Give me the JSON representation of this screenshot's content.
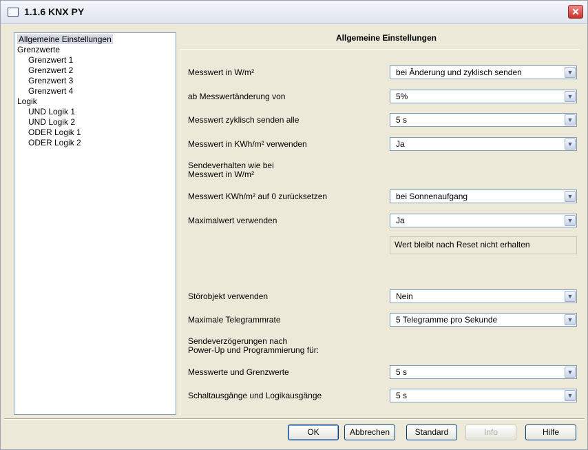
{
  "window": {
    "title": "1.1.6 KNX PY"
  },
  "tree": [
    {
      "label": "Allgemeine Einstellungen",
      "level": 0,
      "selected": true
    },
    {
      "label": "Grenzwerte",
      "level": 0
    },
    {
      "label": "Grenzwert 1",
      "level": 1
    },
    {
      "label": "Grenzwert 2",
      "level": 1
    },
    {
      "label": "Grenzwert 3",
      "level": 1
    },
    {
      "label": "Grenzwert 4",
      "level": 1
    },
    {
      "label": "Logik",
      "level": 0
    },
    {
      "label": "UND Logik 1",
      "level": 1
    },
    {
      "label": "UND Logik 2",
      "level": 1
    },
    {
      "label": "ODER Logik 1",
      "level": 1
    },
    {
      "label": "ODER Logik 2",
      "level": 1
    }
  ],
  "panel": {
    "title": "Allgemeine Einstellungen",
    "settings": [
      {
        "label": "Messwert in W/m²",
        "value": "bei Änderung und zyklisch senden"
      },
      {
        "label": "ab Messwertänderung von",
        "value": "5%"
      },
      {
        "label": "Messwert zyklisch senden alle",
        "value": "5 s"
      },
      {
        "label": "Messwert in KWh/m² verwenden",
        "value": "Ja"
      },
      {
        "label": "Sendeverhalten wie bei",
        "label2": "Messwert in W/m²"
      },
      {
        "label": "Messwert KWh/m² auf 0 zurücksetzen",
        "value": "bei Sonnenaufgang"
      },
      {
        "label": "Maximalwert verwenden",
        "value": "Ja"
      },
      {
        "label": "Störobjekt verwenden",
        "value": "Nein"
      },
      {
        "label": "Maximale Telegrammrate",
        "value": "5 Telegramme pro Sekunde"
      },
      {
        "label": "Sendeverzögerungen nach",
        "label2": "Power-Up und Programmierung für:"
      },
      {
        "label": "Messwerte und Grenzwerte",
        "value": "5 s"
      },
      {
        "label": "Schaltausgänge und Logikausgänge",
        "value": "5 s"
      }
    ],
    "info_text": "Wert bleibt nach Reset nicht erhalten"
  },
  "buttons": {
    "ok": "OK",
    "cancel": "Abbrechen",
    "standard": "Standard",
    "info": "Info",
    "help": "Hilfe"
  },
  "icons": {
    "close": "close-icon",
    "window": "window-icon",
    "dropdown": "chevron-down-icon"
  }
}
